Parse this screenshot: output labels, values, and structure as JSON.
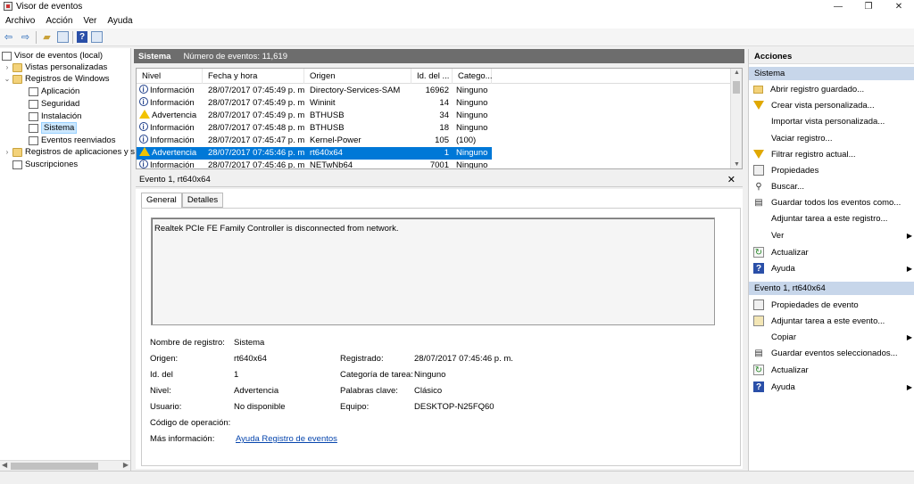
{
  "window": {
    "title": "Visor de eventos"
  },
  "menu": [
    "Archivo",
    "Acción",
    "Ver",
    "Ayuda"
  ],
  "tree": [
    {
      "label": "Visor de eventos (local)",
      "indent": 0,
      "exp": ""
    },
    {
      "label": "Vistas personalizadas",
      "indent": 1,
      "exp": "›"
    },
    {
      "label": "Registros de Windows",
      "indent": 1,
      "exp": "⌄"
    },
    {
      "label": "Aplicación",
      "indent": 2,
      "exp": ""
    },
    {
      "label": "Seguridad",
      "indent": 2,
      "exp": ""
    },
    {
      "label": "Instalación",
      "indent": 2,
      "exp": ""
    },
    {
      "label": "Sistema",
      "indent": 2,
      "exp": "",
      "selected": true
    },
    {
      "label": "Eventos reenviados",
      "indent": 2,
      "exp": ""
    },
    {
      "label": "Registros de aplicaciones y s",
      "indent": 1,
      "exp": "›"
    },
    {
      "label": "Suscripciones",
      "indent": 1,
      "exp": ""
    }
  ],
  "center": {
    "log_name": "Sistema",
    "event_count": "Número de eventos: 11,619",
    "columns": [
      "Nivel",
      "Fecha y hora",
      "Origen",
      "Id. del ...",
      "Catego..."
    ],
    "rows": [
      {
        "level": "Información",
        "type": "info",
        "datetime": "28/07/2017 07:45:49 p. m.",
        "source": "Directory-Services-SAM",
        "id": "16962",
        "category": "Ninguno"
      },
      {
        "level": "Información",
        "type": "info",
        "datetime": "28/07/2017 07:45:49 p. m.",
        "source": "Wininit",
        "id": "14",
        "category": "Ninguno"
      },
      {
        "level": "Advertencia",
        "type": "warn",
        "datetime": "28/07/2017 07:45:49 p. m.",
        "source": "BTHUSB",
        "id": "34",
        "category": "Ninguno"
      },
      {
        "level": "Información",
        "type": "info",
        "datetime": "28/07/2017 07:45:48 p. m.",
        "source": "BTHUSB",
        "id": "18",
        "category": "Ninguno"
      },
      {
        "level": "Información",
        "type": "info",
        "datetime": "28/07/2017 07:45:47 p. m.",
        "source": "Kernel-Power",
        "id": "105",
        "category": "(100)"
      },
      {
        "level": "Advertencia",
        "type": "warn",
        "datetime": "28/07/2017 07:45:46 p. m.",
        "source": "rt640x64",
        "id": "1",
        "category": "Ninguno",
        "selected": true
      },
      {
        "level": "Información",
        "type": "info",
        "datetime": "28/07/2017 07:45:46 p. m.",
        "source": "NETwNb64",
        "id": "7001",
        "category": "Ninguno"
      }
    ]
  },
  "detail": {
    "title": "Evento 1, rt640x64",
    "close": "✕",
    "tabs": [
      "General",
      "Detalles"
    ],
    "message": "Realtek PCIe FE Family Controller is disconnected from network.",
    "props": {
      "log_name_label": "Nombre de registro:",
      "log_name": "Sistema",
      "source_label": "Origen:",
      "source": "rt640x64",
      "logged_label": "Registrado:",
      "logged": "28/07/2017 07:45:46 p. m.",
      "id_label": "Id. del",
      "id": "1",
      "task_label": "Categoría de tarea:",
      "task": "Ninguno",
      "level_label": "Nivel:",
      "level": "Advertencia",
      "keywords_label": "Palabras clave:",
      "keywords": "Clásico",
      "user_label": "Usuario:",
      "user": "No disponible",
      "computer_label": "Equipo:",
      "computer": "DESKTOP-N25FQ60",
      "opcode_label": "Código de operación:",
      "more_label": "Más información:",
      "more_link": "Ayuda Registro de eventos"
    }
  },
  "actions": {
    "title": "Acciones",
    "section1": "Sistema",
    "items1": [
      {
        "label": "Abrir registro guardado...",
        "icon": "folder-icon"
      },
      {
        "label": "Crear vista personalizada...",
        "icon": "filter-icon"
      },
      {
        "label": "Importar vista personalizada...",
        "icon": ""
      },
      {
        "label": "Vaciar registro...",
        "icon": ""
      },
      {
        "label": "Filtrar registro actual...",
        "icon": "filter-icon"
      },
      {
        "label": "Propiedades",
        "icon": "properties-icon"
      },
      {
        "label": "Buscar...",
        "icon": "find-icon"
      },
      {
        "label": "Guardar todos los eventos como...",
        "icon": "save-icon"
      },
      {
        "label": "Adjuntar tarea a este registro...",
        "icon": ""
      },
      {
        "label": "Ver",
        "icon": "",
        "submenu": true
      },
      {
        "label": "Actualizar",
        "icon": "refresh-icon"
      },
      {
        "label": "Ayuda",
        "icon": "help-icon",
        "submenu": true
      }
    ],
    "section2": "Evento 1, rt640x64",
    "items2": [
      {
        "label": "Propiedades de evento",
        "icon": "properties-icon"
      },
      {
        "label": "Adjuntar tarea a este evento...",
        "icon": "task-icon"
      },
      {
        "label": "Copiar",
        "icon": "",
        "submenu": true
      },
      {
        "label": "Guardar eventos seleccionados...",
        "icon": "save-icon"
      },
      {
        "label": "Actualizar",
        "icon": "refresh-icon"
      },
      {
        "label": "Ayuda",
        "icon": "help-icon",
        "submenu": true
      }
    ]
  }
}
